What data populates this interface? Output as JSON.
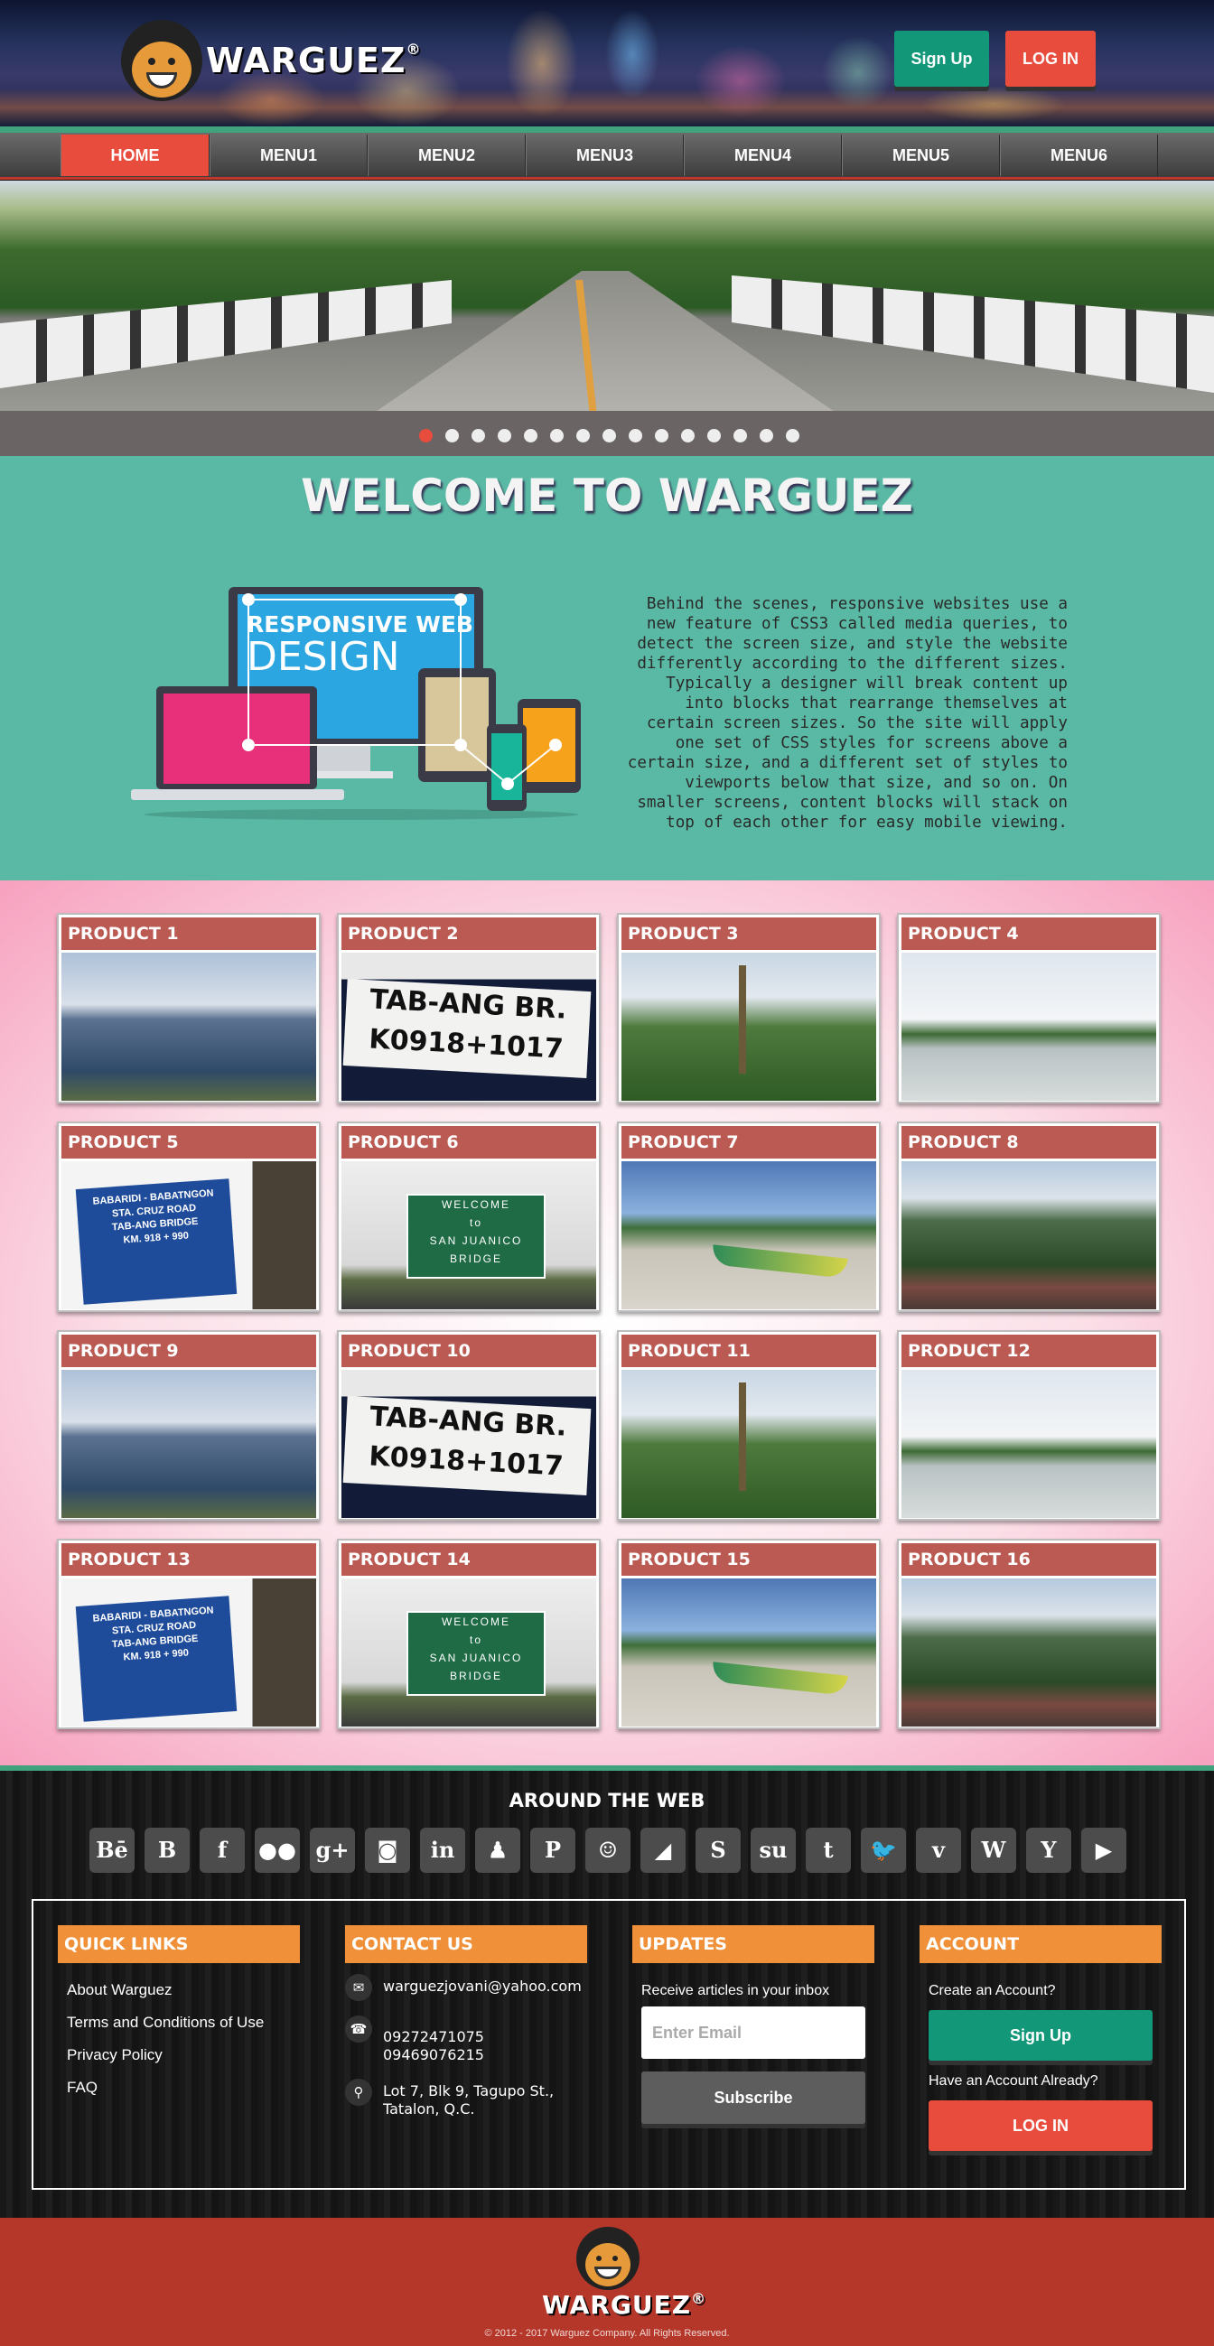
{
  "header": {
    "brand": "WARGUEZ",
    "reg_mark": "®",
    "signup_label": "Sign Up",
    "login_label": "LOG IN"
  },
  "nav": [
    "HOME",
    "MENU1",
    "MENU2",
    "MENU3",
    "MENU4",
    "MENU5",
    "MENU6"
  ],
  "slider": {
    "dot_count": 15,
    "active_index": 0
  },
  "welcome": {
    "title": "WELCOME TO WARGUEZ",
    "image_text_line1": "RESPONSIVE WEB",
    "image_text_line2": "DESIGN",
    "body": "Behind the scenes, responsive websites use a new feature of CSS3 called media queries, to detect the screen size, and style the website differently according to the different sizes. Typically a designer will break content up into blocks that rearrange themselves at certain screen sizes. So the site will apply one set of CSS styles for screens above a certain size, and a different set of styles to viewports below that size, and so on. On smaller screens, content blocks will stack on top of each other for easy mobile viewing."
  },
  "products": [
    {
      "title": "PRODUCT 1",
      "img": "sea"
    },
    {
      "title": "PRODUCT 2",
      "img": "sign"
    },
    {
      "title": "PRODUCT 3",
      "img": "palm"
    },
    {
      "title": "PRODUCT 4",
      "img": "bay"
    },
    {
      "title": "PRODUCT 5",
      "img": "bluesign"
    },
    {
      "title": "PRODUCT 6",
      "img": "welcome"
    },
    {
      "title": "PRODUCT 7",
      "img": "beach"
    },
    {
      "title": "PRODUCT 8",
      "img": "hills"
    },
    {
      "title": "PRODUCT 9",
      "img": "sea"
    },
    {
      "title": "PRODUCT 10",
      "img": "sign"
    },
    {
      "title": "PRODUCT 11",
      "img": "palm"
    },
    {
      "title": "PRODUCT 12",
      "img": "bay"
    },
    {
      "title": "PRODUCT 13",
      "img": "bluesign"
    },
    {
      "title": "PRODUCT 14",
      "img": "welcome"
    },
    {
      "title": "PRODUCT 15",
      "img": "beach"
    },
    {
      "title": "PRODUCT 16",
      "img": "hills"
    }
  ],
  "footer": {
    "around_title": "AROUND THE WEB",
    "social": [
      {
        "name": "behance-icon",
        "glyph": "Bē"
      },
      {
        "name": "blogger-icon",
        "glyph": "B"
      },
      {
        "name": "facebook-icon",
        "glyph": "f"
      },
      {
        "name": "flickr-icon",
        "glyph": "●●"
      },
      {
        "name": "google-plus-icon",
        "glyph": "g+"
      },
      {
        "name": "instagram-icon",
        "glyph": "◙"
      },
      {
        "name": "linkedin-icon",
        "glyph": "in"
      },
      {
        "name": "myspace-icon",
        "glyph": "♟"
      },
      {
        "name": "pinterest-icon",
        "glyph": "P"
      },
      {
        "name": "reddit-icon",
        "glyph": "☺"
      },
      {
        "name": "rss-icon",
        "glyph": "◢"
      },
      {
        "name": "skype-icon",
        "glyph": "S"
      },
      {
        "name": "stumbleupon-icon",
        "glyph": "su"
      },
      {
        "name": "tumblr-icon",
        "glyph": "t"
      },
      {
        "name": "twitter-icon",
        "glyph": "🐦"
      },
      {
        "name": "vimeo-icon",
        "glyph": "v"
      },
      {
        "name": "wikipedia-icon",
        "glyph": "W"
      },
      {
        "name": "yahoo-icon",
        "glyph": "Y"
      },
      {
        "name": "youtube-icon",
        "glyph": "▶"
      }
    ],
    "quick_links": {
      "title": "QUICK LINKS",
      "items": [
        "About Warguez",
        "Terms and Conditions of Use",
        "Privacy Policy",
        "FAQ"
      ]
    },
    "contact": {
      "title": "CONTACT US",
      "email": "warguezjovani@yahoo.com",
      "phone1": "09272471075",
      "phone2": "09469076215",
      "address1": "Lot 7, Blk 9, Tagupo St.,",
      "address2": "Tatalon, Q.C."
    },
    "updates": {
      "title": "UPDATES",
      "label": "Receive articles in your inbox",
      "placeholder": "Enter Email",
      "subscribe_label": "Subscribe"
    },
    "account": {
      "title": "ACCOUNT",
      "create_label": "Create an Account?",
      "signup_label": "Sign Up",
      "have_label": "Have an Account Already?",
      "login_label": "LOG IN"
    }
  },
  "bottom": {
    "brand": "WARGUEZ",
    "reg_mark": "®",
    "copyright": "© 2012 - 2017 Warguez Company. All Rights Reserved."
  },
  "colors": {
    "accent_red": "#e84c3d",
    "accent_green": "#129878",
    "teal": "#5ab9a4",
    "orange": "#f0913a",
    "product_header": "#ba5a52"
  }
}
